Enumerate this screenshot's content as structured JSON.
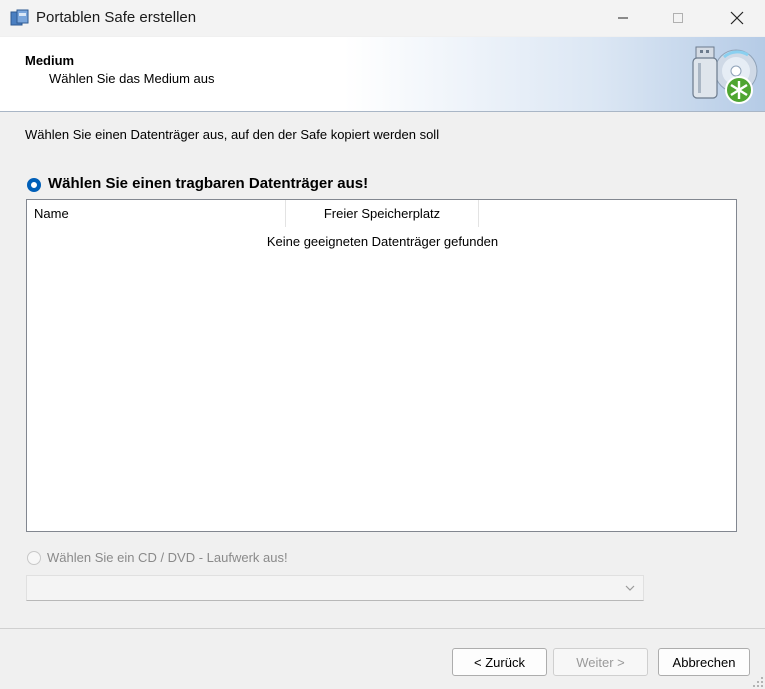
{
  "window": {
    "title": "Portablen Safe erstellen",
    "minimize_glyph": "—",
    "maximize_glyph": "☐",
    "close_glyph": "✕"
  },
  "header": {
    "title": "Medium",
    "subtitle": "Wählen Sie das Medium aus",
    "icon": "usb-drive-cd-icon"
  },
  "instruction": "Wählen Sie einen Datenträger aus, auf den der Safe kopiert werden soll",
  "option_usb": {
    "label": "Wählen Sie einen tragbaren Datenträger aus!",
    "selected": true
  },
  "list": {
    "columns": [
      "Name",
      "Freier Speicherplatz"
    ],
    "empty_message": "Keine geeigneten Datenträger gefunden"
  },
  "option_cd": {
    "label": "Wählen Sie ein CD / DVD - Laufwerk aus!",
    "selected": false,
    "enabled": false
  },
  "cd_dropdown": {
    "value": ""
  },
  "buttons": {
    "back": "< Zurück",
    "next": "Weiter >",
    "cancel": "Abbrechen"
  },
  "colors": {
    "accent": "#005fb8",
    "header_gradient_end": "#b5cbe6",
    "disabled_text": "#8a8a8a"
  }
}
